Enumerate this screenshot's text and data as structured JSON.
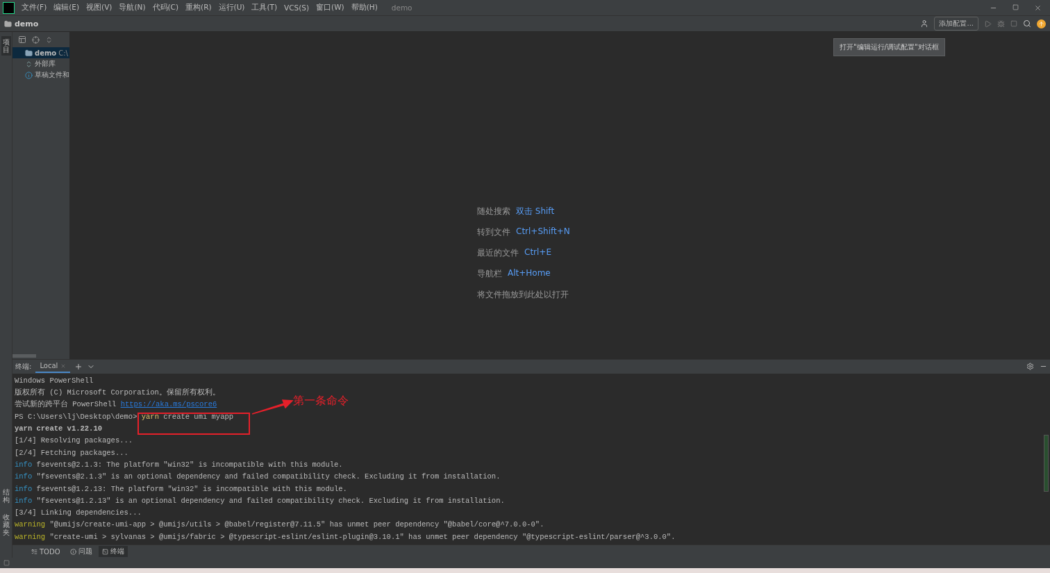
{
  "menu_bar": {
    "items": [
      "文件(F)",
      "编辑(E)",
      "视图(V)",
      "导航(N)",
      "代码(C)",
      "重构(R)",
      "运行(U)",
      "工具(T)",
      "VCS(S)",
      "窗口(W)",
      "帮助(H)"
    ],
    "title": "demo"
  },
  "nav_bar": {
    "breadcrumb": "demo",
    "run_config_button": "添加配置...",
    "tooltip": "打开\"编辑运行/调试配置\"对话框"
  },
  "left_strip": {
    "tabs": [
      {
        "label": "项目",
        "selected": true
      },
      {
        "label": "结构",
        "selected": false
      },
      {
        "label": "收藏夹",
        "selected": false
      }
    ]
  },
  "project_tree": {
    "items": [
      {
        "label": "demo",
        "path": "C:\\",
        "selected": true,
        "kind": "folder"
      },
      {
        "label": "外部库",
        "selected": false,
        "kind": "library"
      },
      {
        "label": "草稿文件和",
        "selected": false,
        "kind": "scratch"
      }
    ]
  },
  "editor_hints": [
    {
      "label": "随处搜索",
      "shortcut": "双击 Shift"
    },
    {
      "label": "转到文件",
      "shortcut": "Ctrl+Shift+N"
    },
    {
      "label": "最近的文件",
      "shortcut": "Ctrl+E"
    },
    {
      "label": "导航栏",
      "shortcut": "Alt+Home"
    },
    {
      "label": "将文件拖放到此处以打开"
    }
  ],
  "terminal": {
    "title": "终端:",
    "tabs": [
      {
        "label": "Local",
        "selected": true
      }
    ],
    "lines": [
      [
        {
          "kind": "plain",
          "text": "Windows PowerShell"
        }
      ],
      [
        {
          "kind": "plain",
          "text": "版权所有 (C) Microsoft Corporation。保留所有权利。"
        }
      ],
      [
        {
          "kind": "plain",
          "text": "尝试新的跨平台 PowerShell "
        },
        {
          "kind": "link",
          "text": "https://aka.ms/pscore6"
        }
      ],
      [
        {
          "kind": "plain",
          "text": "PS C:\\Users\\lj\\Desktop\\demo> "
        },
        {
          "kind": "keyword",
          "text": "yarn"
        },
        {
          "kind": "plain",
          "text": " create umi myapp"
        }
      ],
      [
        {
          "kind": "bold",
          "text": "yarn create v1.22.10"
        }
      ],
      [
        {
          "kind": "plain",
          "text": "[1/4] Resolving packages..."
        }
      ],
      [
        {
          "kind": "plain",
          "text": "[2/4] Fetching packages..."
        }
      ],
      [
        {
          "kind": "info",
          "text": "info"
        },
        {
          "kind": "plain",
          "text": " fsevents@2.1.3: The platform \"win32\" is incompatible with this module."
        }
      ],
      [
        {
          "kind": "info",
          "text": "info"
        },
        {
          "kind": "plain",
          "text": " \"fsevents@2.1.3\" is an optional dependency and failed compatibility check. Excluding it from installation."
        }
      ],
      [
        {
          "kind": "info",
          "text": "info"
        },
        {
          "kind": "plain",
          "text": " fsevents@1.2.13: The platform \"win32\" is incompatible with this module."
        }
      ],
      [
        {
          "kind": "info",
          "text": "info"
        },
        {
          "kind": "plain",
          "text": " \"fsevents@1.2.13\" is an optional dependency and failed compatibility check. Excluding it from installation."
        }
      ],
      [
        {
          "kind": "plain",
          "text": "[3/4] Linking dependencies..."
        }
      ],
      [
        {
          "kind": "warning",
          "text": "warning"
        },
        {
          "kind": "plain",
          "text": " \"@umijs/create-umi-app > @umijs/utils > @babel/register@7.11.5\" has unmet peer dependency \"@babel/core@^7.0.0-0\"."
        }
      ],
      [
        {
          "kind": "warning",
          "text": "warning"
        },
        {
          "kind": "plain",
          "text": " \"create-umi > sylvanas > @umijs/fabric > @typescript-eslint/eslint-plugin@3.10.1\" has unmet peer dependency \"@typescript-eslint/parser@^3.0.0\"."
        }
      ]
    ],
    "annotation": "第一条命令"
  },
  "tool_windows": [
    {
      "label": "TODO",
      "selected": false,
      "kind": "todo"
    },
    {
      "label": "问题",
      "selected": false,
      "kind": "problems"
    },
    {
      "label": "终端",
      "selected": true,
      "kind": "terminal"
    }
  ]
}
